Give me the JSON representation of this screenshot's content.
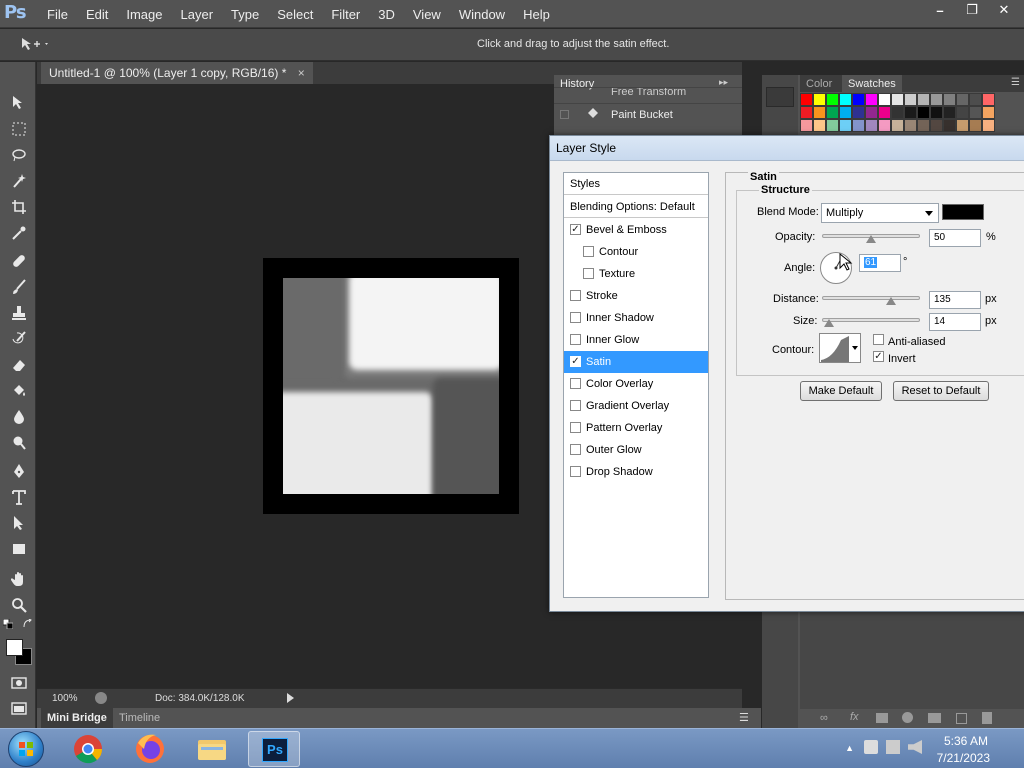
{
  "app": {
    "logo": "Ps",
    "menu": [
      "File",
      "Edit",
      "Image",
      "Layer",
      "Type",
      "Select",
      "Filter",
      "3D",
      "View",
      "Window",
      "Help"
    ],
    "window_controls": [
      "–",
      "❐",
      "✕"
    ]
  },
  "options_bar": {
    "hint": "Click and drag to adjust the satin effect."
  },
  "document": {
    "tab_title": "Untitled-1 @ 100% (Layer 1 copy, RGB/16) *",
    "close_glyph": "×",
    "zoom": "100%",
    "doc_info": "Doc: 384.0K/128.0K"
  },
  "bottom_tabs": [
    "Mini Bridge",
    "Timeline"
  ],
  "history": {
    "tab": "History",
    "items": [
      "Free Transform",
      "Paint Bucket"
    ]
  },
  "swatches_panel": {
    "tabs": [
      "Color",
      "Swatches"
    ],
    "colors": [
      "#ff0000",
      "#ffff00",
      "#00ff00",
      "#00ffff",
      "#0000ff",
      "#ff00ff",
      "#ffffff",
      "#e6e6e6",
      "#cccccc",
      "#b3b3b3",
      "#999999",
      "#808080",
      "#666666",
      "#4d4d4d",
      "#ff6666",
      "#ee1c24",
      "#f7941d",
      "#00a651",
      "#00aeef",
      "#2e3192",
      "#92278f",
      "#ec008c",
      "#333333",
      "#1a1a1a",
      "#000000",
      "#111111",
      "#222222",
      "#444444",
      "#555555",
      "#f4a460",
      "#f6989d",
      "#fdc689",
      "#82ca9c",
      "#6dcff6",
      "#8393ca",
      "#a187be",
      "#f49ac2",
      "#c7b299",
      "#998675",
      "#736357",
      "#534741",
      "#37302d",
      "#c69c6d",
      "#a67c52",
      "#f7b080"
    ]
  },
  "dialog": {
    "title": "Layer Style",
    "styles_header": "Styles",
    "blending": "Blending Options: Default",
    "style_items": [
      {
        "label": "Bevel & Emboss",
        "checked": true,
        "indent": false,
        "selected": false
      },
      {
        "label": "Contour",
        "checked": false,
        "indent": true,
        "selected": false
      },
      {
        "label": "Texture",
        "checked": false,
        "indent": true,
        "selected": false
      },
      {
        "label": "Stroke",
        "checked": false,
        "indent": false,
        "selected": false
      },
      {
        "label": "Inner Shadow",
        "checked": false,
        "indent": false,
        "selected": false
      },
      {
        "label": "Inner Glow",
        "checked": false,
        "indent": false,
        "selected": false
      },
      {
        "label": "Satin",
        "checked": true,
        "indent": false,
        "selected": true
      },
      {
        "label": "Color Overlay",
        "checked": false,
        "indent": false,
        "selected": false
      },
      {
        "label": "Gradient Overlay",
        "checked": false,
        "indent": false,
        "selected": false
      },
      {
        "label": "Pattern Overlay",
        "checked": false,
        "indent": false,
        "selected": false
      },
      {
        "label": "Outer Glow",
        "checked": false,
        "indent": false,
        "selected": false
      },
      {
        "label": "Drop Shadow",
        "checked": false,
        "indent": false,
        "selected": false
      }
    ],
    "section_title": "Satin",
    "group_title": "Structure",
    "blend_mode_label": "Blend Mode:",
    "blend_mode_value": "Multiply",
    "blend_color": "#000000",
    "opacity_label": "Opacity:",
    "opacity_value": "50",
    "opacity_unit": "%",
    "opacity_fraction": 0.5,
    "angle_label": "Angle:",
    "angle_value": "61",
    "angle_unit": "°",
    "distance_label": "Distance:",
    "distance_value": "135",
    "distance_unit": "px",
    "distance_fraction": 0.7,
    "size_label": "Size:",
    "size_value": "14",
    "size_unit": "px",
    "size_fraction": 0.07,
    "contour_label": "Contour:",
    "anti_aliased_label": "Anti-aliased",
    "anti_aliased_checked": false,
    "invert_label": "Invert",
    "invert_checked": true,
    "make_default": "Make Default",
    "reset_default": "Reset to Default"
  },
  "taskbar": {
    "time": "5:36 AM",
    "date": "7/21/2023",
    "ps_label": "Ps"
  }
}
